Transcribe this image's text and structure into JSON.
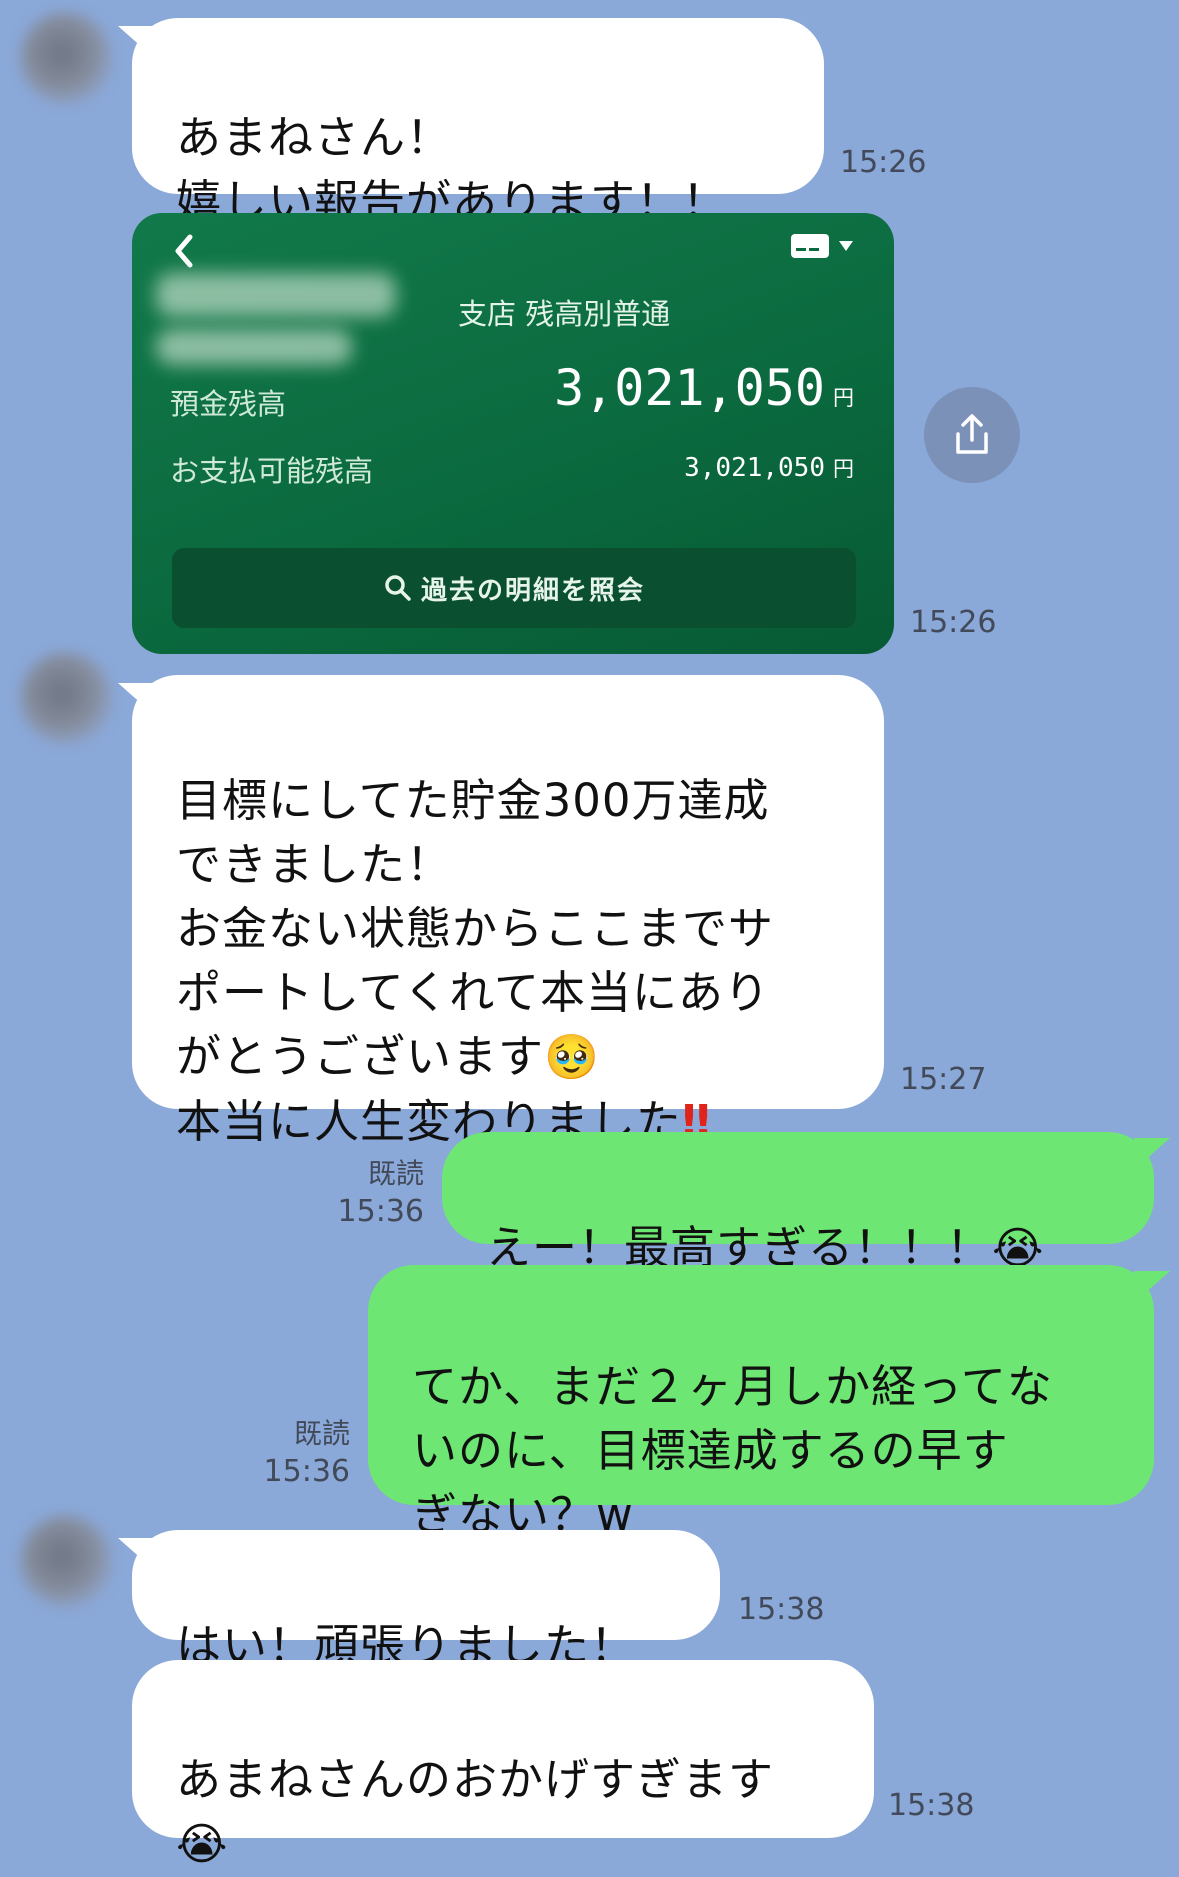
{
  "chat": {
    "m1": {
      "lines": "あまねさん！\n嬉しい報告があります！！",
      "time": "15:26"
    },
    "card": {
      "branch": "支店 残高別普通",
      "deposit_label": "預金残高",
      "deposit_amount": "3,021,050",
      "available_label": "お支払可能残高",
      "available_amount": "3,021,050",
      "yen": "円",
      "statement_button": "過去の明細を照会",
      "time": "15:26"
    },
    "m3": {
      "lines": "目標にしてた貯金300万達成\nできました！\nお金ない状態からここまでサ\nポートしてくれて本当にあり\nがとうございます",
      "emoji1": "🥹",
      "last_line": "本当に人生変わりました",
      "emoji2": "‼",
      "time": "15:27"
    },
    "o1": {
      "text": "えー！最高すぎる！！！",
      "emoji": "😭",
      "read": "既読",
      "time": "15:36"
    },
    "o2": {
      "lines": "てか、まだ２ヶ月しか経ってな\nいのに、目標達成するの早す\nぎない？w",
      "read": "既読",
      "time": "15:36"
    },
    "m4": {
      "text": "はい！頑張りました！",
      "time": "15:38"
    },
    "m5": {
      "text": "あまねさんのおかげすぎます",
      "emoji": "😭",
      "time": "15:38"
    }
  },
  "colors": {
    "background": "#8aa8d8",
    "outgoing": "#6ee674",
    "incoming": "#ffffff",
    "card": "#0b6a3f"
  },
  "icons": [
    "back-chevron-icon",
    "card-icon",
    "dropdown-icon",
    "search-icon",
    "share-icon"
  ]
}
